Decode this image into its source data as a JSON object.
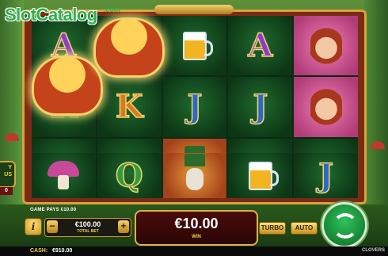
{
  "watermark": {
    "brand": "SlotCatalog",
    "suffix": ".com"
  },
  "side_feature": {
    "label": "BUY\nBONUS",
    "label_visible": "Y\nUS",
    "count": "0"
  },
  "reels": [
    [
      "A",
      "K",
      "Q"
    ],
    [
      "pot-of-gold",
      "K",
      "Q"
    ],
    [
      "beer",
      "leprechaun",
      "leprechaun"
    ],
    [
      "A",
      "J",
      "beer"
    ],
    [
      "lady",
      "J",
      "J"
    ]
  ],
  "reels_rows": [
    [
      {
        "type": "letter",
        "value": "A",
        "style": "A"
      },
      {
        "type": "pot",
        "value": ""
      },
      {
        "type": "beer",
        "value": ""
      },
      {
        "type": "letter",
        "value": "A",
        "style": "A"
      },
      {
        "type": "lady",
        "value": ""
      }
    ],
    [
      {
        "type": "letter",
        "value": "K",
        "style": "K"
      },
      {
        "type": "letter",
        "value": "K",
        "style": "K"
      },
      {
        "type": "letter",
        "value": "J",
        "style": "J"
      },
      {
        "type": "letter",
        "value": "J",
        "style": "J"
      },
      {
        "type": "lady",
        "value": ""
      }
    ],
    [
      {
        "type": "letter",
        "value": "Q",
        "style": "Q"
      },
      {
        "type": "letter",
        "value": "K",
        "style": "K"
      },
      {
        "type": "leprechaun",
        "value": ""
      },
      {
        "type": "beer",
        "value": ""
      },
      {
        "type": "letter",
        "value": "J",
        "style": "J"
      }
    ],
    [
      {
        "type": "mushroom",
        "value": ""
      },
      {
        "type": "letter",
        "value": "Q",
        "style": "Q"
      },
      {
        "type": "leprechaun",
        "value": ""
      },
      {
        "type": "beer",
        "value": ""
      },
      {
        "type": "letter",
        "value": "J",
        "style": "J"
      }
    ]
  ],
  "info": {
    "game_pays": "GAME PAYS €10.00",
    "info_glyph": "i"
  },
  "bet": {
    "value": "€100.00",
    "label": "TOTAL BET",
    "minus": "−",
    "plus": "+"
  },
  "win": {
    "value": "€10.00",
    "label": "WIN"
  },
  "buttons": {
    "turbo": "TURBO",
    "auto": "AUTO"
  },
  "footer": {
    "cash_label": "CASH:",
    "cash_value": "€910.00",
    "game_name": "CLOVERS"
  },
  "colors": {
    "frame": "#7a2b14",
    "gold": "#d6a43c",
    "accent_green": "#2fc25a"
  }
}
